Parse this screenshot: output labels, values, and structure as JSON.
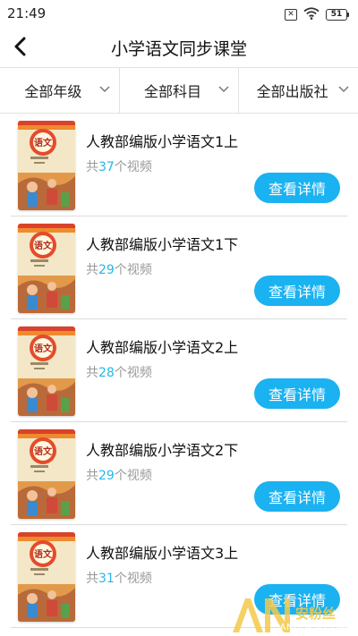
{
  "status_bar": {
    "time": "21:49",
    "battery": "51"
  },
  "header": {
    "title": "小学语文同步课堂"
  },
  "filters": [
    {
      "label": "全部年级"
    },
    {
      "label": "全部科目"
    },
    {
      "label": "全部出版社"
    }
  ],
  "books": [
    {
      "title": "人教部编版小学语文1上",
      "prefix": "共",
      "count": "37",
      "suffix": "个视频",
      "button": "查看详情",
      "cover_text": "语文"
    },
    {
      "title": "人教部编版小学语文1下",
      "prefix": "共",
      "count": "29",
      "suffix": "个视频",
      "button": "查看详情",
      "cover_text": "语文"
    },
    {
      "title": "人教部编版小学语文2上",
      "prefix": "共",
      "count": "28",
      "suffix": "个视频",
      "button": "查看详情",
      "cover_text": "语文"
    },
    {
      "title": "人教部编版小学语文2下",
      "prefix": "共",
      "count": "29",
      "suffix": "个视频",
      "button": "查看详情",
      "cover_text": "语文"
    },
    {
      "title": "人教部编版小学语文3上",
      "prefix": "共",
      "count": "31",
      "suffix": "个视频",
      "button": "查看详情",
      "cover_text": "语文"
    }
  ],
  "watermark": {
    "brand": "安粉丝",
    "domain": "ANFENSI.COM"
  },
  "colors": {
    "accent": "#1ab2f1",
    "count": "#26b6e8",
    "cover_orange": "#f08a2c"
  }
}
